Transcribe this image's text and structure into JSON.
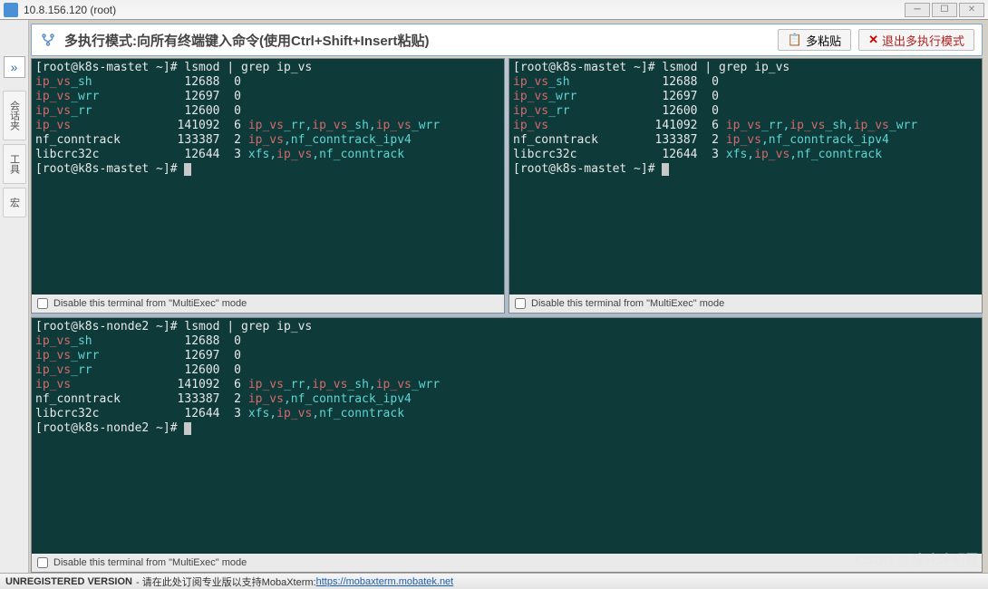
{
  "title": "10.8.156.120 (root)",
  "multiexec": {
    "label": "多执行模式:向所有终端键入命令(使用Ctrl+Shift+Insert粘贴)",
    "paste_btn": "多粘贴",
    "exit_btn": "退出多执行模式"
  },
  "sidebar": {
    "arrow": "»",
    "tabs": [
      "会话夹",
      "工具",
      "宏"
    ]
  },
  "terminals": [
    {
      "id": "t1",
      "host": "k8s-mastet",
      "prompt_user": "root",
      "command": "lsmod | grep ip_vs",
      "rows": [
        {
          "mod": "ip_vs_sh",
          "c1": "12688",
          "c2": "0",
          "deps": ""
        },
        {
          "mod": "ip_vs_wrr",
          "c1": "12697",
          "c2": "0",
          "deps": ""
        },
        {
          "mod": "ip_vs_rr",
          "c1": "12600",
          "c2": "0",
          "deps": ""
        },
        {
          "mod": "ip_vs",
          "c1": "141092",
          "c2": "6",
          "deps": "ip_vs_rr,ip_vs_sh,ip_vs_wrr",
          "red_deps": true
        },
        {
          "mod": "nf_conntrack",
          "c1": "133387",
          "c2": "2",
          "deps": "ip_vs,nf_conntrack_ipv4",
          "mix": true
        },
        {
          "mod": "libcrc32c",
          "c1": "12644",
          "c2": "3",
          "deps": "xfs,ip_vs,nf_conntrack",
          "mix2": true,
          "plain": true
        }
      ],
      "footer": "Disable this terminal from \"MultiExec\" mode"
    },
    {
      "id": "t2",
      "host": "k8s-mastet",
      "prompt_user": "root",
      "command": "lsmod | grep ip_vs",
      "rows": [
        {
          "mod": "ip_vs_sh",
          "c1": "12688",
          "c2": "0",
          "deps": ""
        },
        {
          "mod": "ip_vs_wrr",
          "c1": "12697",
          "c2": "0",
          "deps": ""
        },
        {
          "mod": "ip_vs_rr",
          "c1": "12600",
          "c2": "0",
          "deps": ""
        },
        {
          "mod": "ip_vs",
          "c1": "141092",
          "c2": "6",
          "deps": "ip_vs_rr,ip_vs_sh,ip_vs_wrr",
          "red_deps": true
        },
        {
          "mod": "nf_conntrack",
          "c1": "133387",
          "c2": "2",
          "deps": "ip_vs,nf_conntrack_ipv4",
          "mix": true
        },
        {
          "mod": "libcrc32c",
          "c1": "12644",
          "c2": "3",
          "deps": "xfs,ip_vs,nf_conntrack",
          "mix2": true,
          "plain": true
        }
      ],
      "footer": "Disable this terminal from \"MultiExec\" mode"
    },
    {
      "id": "t3",
      "host": "k8s-nonde2",
      "prompt_user": "root",
      "command": "lsmod | grep ip_vs",
      "rows": [
        {
          "mod": "ip_vs_sh",
          "c1": "12688",
          "c2": "0",
          "deps": ""
        },
        {
          "mod": "ip_vs_wrr",
          "c1": "12697",
          "c2": "0",
          "deps": ""
        },
        {
          "mod": "ip_vs_rr",
          "c1": "12600",
          "c2": "0",
          "deps": ""
        },
        {
          "mod": "ip_vs",
          "c1": "141092",
          "c2": "6",
          "deps": "ip_vs_rr,ip_vs_sh,ip_vs_wrr",
          "red_deps": true
        },
        {
          "mod": "nf_conntrack",
          "c1": "133387",
          "c2": "2",
          "deps": "ip_vs,nf_conntrack_ipv4",
          "mix": true
        },
        {
          "mod": "libcrc32c",
          "c1": "12644",
          "c2": "3",
          "deps": "xfs,ip_vs,nf_conntrack",
          "mix2": true,
          "plain": true
        }
      ],
      "footer": "Disable this terminal from \"MultiExec\" mode"
    }
  ],
  "status": {
    "unreg": "UNREGISTERED VERSION",
    "cn": " - 请在此处订阅专业版以支持MobaXterm: ",
    "link": "https://mobaxterm.mobatek.net"
  },
  "watermark": "CSDN @哇咔咔明霄"
}
